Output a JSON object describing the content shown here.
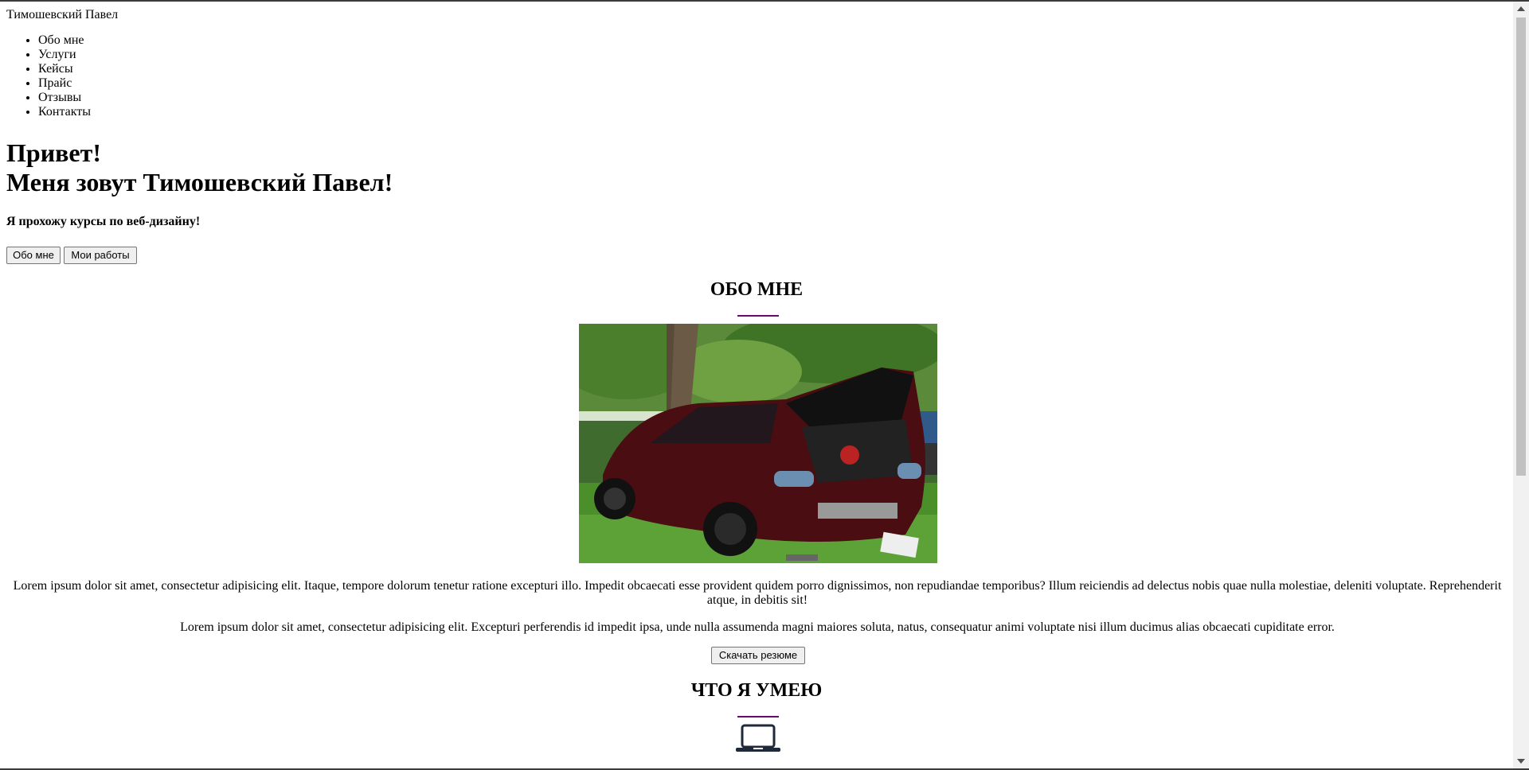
{
  "header": {
    "brand": "Тимошевский Павел"
  },
  "nav": {
    "items": [
      {
        "label": "Обо мне"
      },
      {
        "label": "Услуги"
      },
      {
        "label": "Кейсы"
      },
      {
        "label": "Прайс"
      },
      {
        "label": "Отзывы"
      },
      {
        "label": "Контакты"
      }
    ]
  },
  "hero": {
    "title_line1": "Привет!",
    "title_line2": "Меня зовут Тимошевский Павел!",
    "subtitle": "Я прохожу курсы по веб-дизайну!",
    "button_about": "Обо мне",
    "button_works": "Мои работы"
  },
  "about": {
    "title": "ОБО МНЕ",
    "paragraph1": "Lorem ipsum dolor sit amet, consectetur adipisicing elit. Itaque, tempore dolorum tenetur ratione excepturi illo. Impedit obcaecati esse provident quidem porro dignissimos, non repudiandae temporibus? Illum reiciendis ad delectus nobis quae nulla molestiae, deleniti voluptate. Reprehenderit atque, in debitis sit!",
    "paragraph2": "Lorem ipsum dolor sit amet, consectetur adipisicing elit. Excepturi perferendis id impedit ipsa, unde nulla assumenda magni maiores soluta, natus, consequatur animi voluptate nisi illum ducimus alias obcaecati cupiditate error.",
    "resume_button": "Скачать резюме"
  },
  "skills": {
    "title": "ЧТО Я УМЕЮ",
    "icon": "laptop-icon"
  },
  "colors": {
    "divider": "#6a0a6a",
    "icon": "#1e2a3a"
  }
}
